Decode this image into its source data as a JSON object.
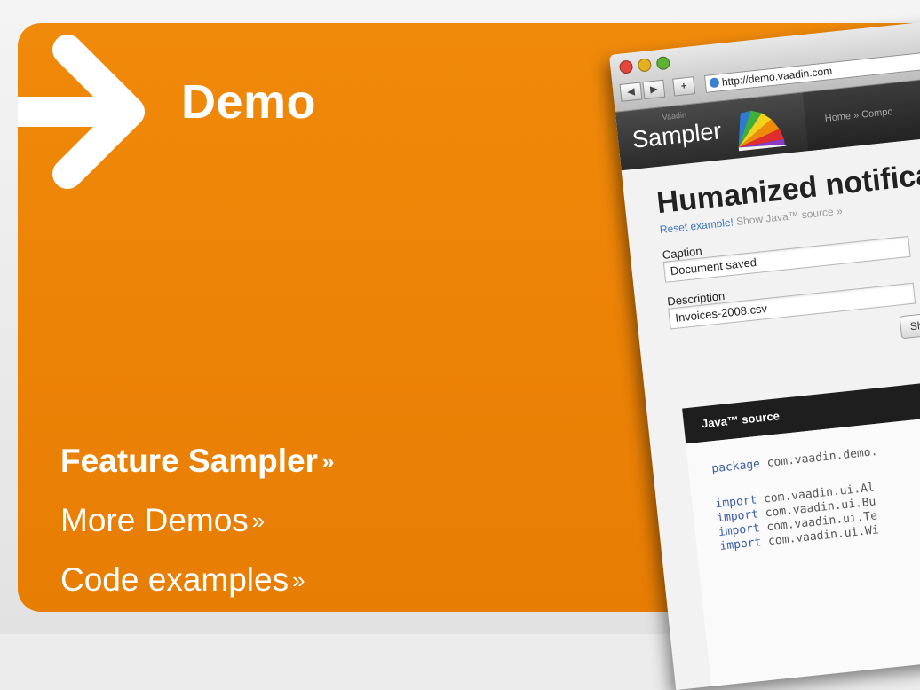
{
  "title": "Demo",
  "links": [
    {
      "label": "Feature Sampler",
      "suffix": "»"
    },
    {
      "label": "More Demos",
      "suffix": "»"
    },
    {
      "label": "Code examples",
      "suffix": "»"
    }
  ],
  "browser": {
    "url": "http://demo.vaadin.com",
    "app": {
      "logo_small": "Vaadin",
      "logo": "Sampler",
      "nav": "Home » Compo"
    },
    "heading": "Humanized notificat",
    "reset_link": "Reset example!",
    "show_source": "Show Java™ source »",
    "caption_label": "Caption",
    "caption_value": "Document saved",
    "description_label": "Description",
    "description_value": "Invoices-2008.csv",
    "show_button": "Sho",
    "source_title": "Java™ source",
    "code": {
      "package_kw": "package",
      "package_name": "com.vaadin.demo.",
      "import_kw": "import",
      "imports": [
        "com.vaadin.ui.Al",
        "com.vaadin.ui.Bu",
        "com.vaadin.ui.Te",
        "com.vaadin.ui.Wi"
      ]
    }
  },
  "colors": {
    "accent": "#ec8206",
    "text": "#ffffff"
  }
}
